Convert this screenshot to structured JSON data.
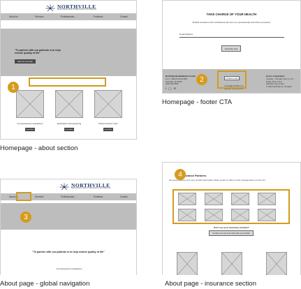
{
  "brand": {
    "name": "NORTHVILLE",
    "tagline": "BEHAVIORAL HEALTH SERVICES & COUNSELING",
    "navy": "#1f3a68",
    "highlight": "#d39b1c",
    "badge": "#d69b1e"
  },
  "nav": {
    "items": [
      "About us",
      "Services",
      "Professionals",
      "Problems",
      "Contact"
    ],
    "professionals_chevron_icon": "chevron-down-icon"
  },
  "panel1": {
    "caption": "Homepage - about section",
    "badge": "1",
    "quote": "\"To partner with our patients is to help restore quality of life\"",
    "cta": "How we can help",
    "cards": [
      {
        "label": "Comprehensive evaluations",
        "button": "Learn More"
      },
      {
        "label": "Dedicated to Empowering",
        "button": "Learn More"
      },
      {
        "label": "Patient-Centric Care",
        "button": "Learn More"
      }
    ]
  },
  "panel2": {
    "caption": "Homepage - footer CTA",
    "badge": "2",
    "title": "TAKE CHARGE OF YOUR HEALTH",
    "subtitle": "Mindful reminders with mindfulness tips from our professionals and clinic promotions",
    "email_label": "Email Address",
    "subscribe": "Subscribe Now",
    "footer_left": {
      "title": "Northville Rehabilitation Center",
      "lines": [
        "Lot 2 - 5862 Terminal Blvd",
        "Northville, MI 48167",
        "(555) 555-5555"
      ]
    },
    "footer_center": {
      "button": "Contact us here",
      "line1": "contact@northville.com",
      "line2": "Website: northville.com"
    },
    "footer_right": {
      "title": "Hours of Operation",
      "lines": [
        "Tuesday - Thursday: 8am to 7pm",
        "Friday: 8am to 5pm",
        "Saturday: 9am to 5pm",
        "© 2024 Northville Inc. All rights"
      ]
    }
  },
  "panel3": {
    "caption": "About page - global navigation",
    "badge": "3",
    "quote": "\"To partner with our patients is to help restore quality of life\"",
    "section_label": "Comprehensive evaluations"
  },
  "panel4": {
    "caption": "About page - insurance section",
    "badge": "4",
    "title": "Insurance Partners",
    "intro": "We accept insurance from many providers listed below. Please contact our office to verify coverage before your first visit.",
    "question": "Don't see your insurance provider?",
    "contact_button": "Contact us to see if we work with your provider"
  }
}
